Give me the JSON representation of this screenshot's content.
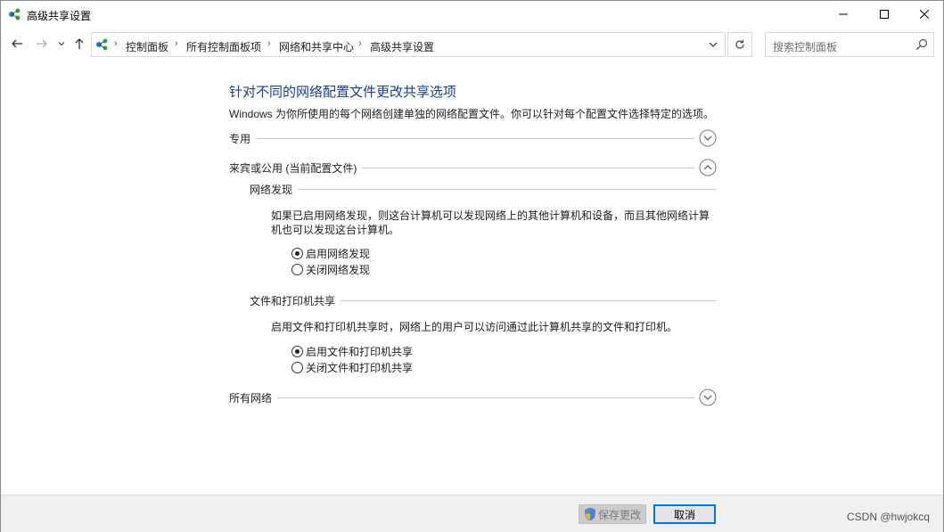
{
  "window": {
    "title": "高级共享设置"
  },
  "address": {
    "breadcrumbs": [
      "控制面板",
      "所有控制面板项",
      "网络和共享中心",
      "高级共享设置"
    ],
    "separator": "›"
  },
  "search": {
    "placeholder": "搜索控制面板"
  },
  "main": {
    "heading": "针对不同的网络配置文件更改共享选项",
    "description": "Windows 为你所使用的每个网络创建单独的网络配置文件。你可以针对每个配置文件选择特定的选项。",
    "profiles": [
      {
        "label": "专用",
        "expanded": false
      },
      {
        "label": "来宾或公用 (当前配置文件)",
        "expanded": true
      },
      {
        "label": "所有网络",
        "expanded": false
      }
    ],
    "network_discovery": {
      "label": "网络发现",
      "text": "如果已启用网络发现，则这台计算机可以发现网络上的其他计算机和设备，而且其他网络计算机也可以发现这台计算机。",
      "options": [
        {
          "label": "启用网络发现",
          "checked": true
        },
        {
          "label": "关闭网络发现",
          "checked": false
        }
      ]
    },
    "file_printer_sharing": {
      "label": "文件和打印机共享",
      "text": "启用文件和打印机共享时，网络上的用户可以访问通过此计算机共享的文件和打印机。",
      "options": [
        {
          "label": "启用文件和打印机共享",
          "checked": true
        },
        {
          "label": "关闭文件和打印机共享",
          "checked": false
        }
      ]
    }
  },
  "footer": {
    "save_label": "保存更改",
    "cancel_label": "取消"
  },
  "watermark": "CSDN @hwjokcq",
  "colors": {
    "heading": "#1a3e8c",
    "accent": "#0078d7"
  }
}
